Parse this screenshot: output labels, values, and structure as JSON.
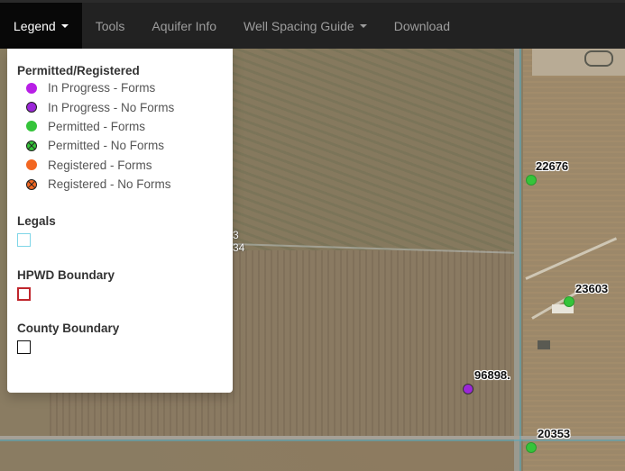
{
  "nav": {
    "items": [
      {
        "label": "Legend",
        "dropdown": true,
        "active": true
      },
      {
        "label": "Tools",
        "dropdown": false
      },
      {
        "label": "Aquifer Info",
        "dropdown": false
      },
      {
        "label": "Well Spacing Guide",
        "dropdown": true
      },
      {
        "label": "Download",
        "dropdown": false
      }
    ]
  },
  "legend": {
    "permitted_title": "Permitted/Registered",
    "items": [
      {
        "label": "In Progress - Forms",
        "color": "#b81fe6",
        "border": "#b81fe6",
        "cross": false
      },
      {
        "label": "In Progress - No Forms",
        "color": "#9b27d8",
        "border": "#222222",
        "cross": false
      },
      {
        "label": "Permitted - Forms",
        "color": "#35c43a",
        "border": "#35c43a",
        "cross": false
      },
      {
        "label": "Permitted - No Forms",
        "color": "#35c43a",
        "border": "#222222",
        "cross": true
      },
      {
        "label": "Registered - Forms",
        "color": "#f26722",
        "border": "#f26722",
        "cross": false
      },
      {
        "label": "Registered - No Forms",
        "color": "#f26722",
        "border": "#222222",
        "cross": true
      }
    ],
    "legals_title": "Legals",
    "legals_color": "#7fd6e8",
    "hpwd_title": "HPWD Boundary",
    "hpwd_color": "#c0272d",
    "county_title": "County Boundary",
    "county_color": "#111111"
  },
  "map": {
    "wells": [
      {
        "id": "22676",
        "type": "permitted"
      },
      {
        "id": "23603",
        "type": "permitted"
      },
      {
        "id": "96898.",
        "type": "inprogress-noforms"
      },
      {
        "id": "20353",
        "type": "permitted"
      }
    ],
    "parcel_labels": [
      "3",
      "34"
    ]
  }
}
